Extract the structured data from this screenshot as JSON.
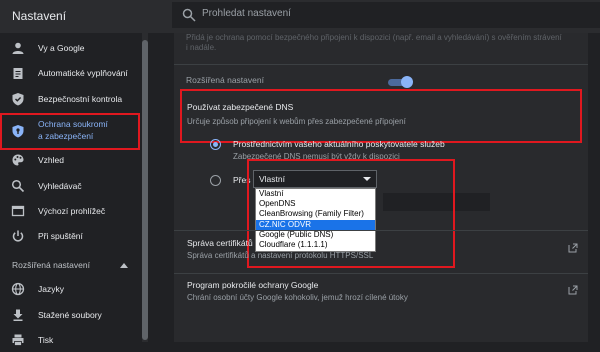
{
  "header": {
    "title": "Nastavení",
    "search_placeholder": "Prohledat nastavení"
  },
  "sidebar": {
    "items": [
      {
        "label": "Vy a Google",
        "icon": "person-icon"
      },
      {
        "label": "Automatické vyplňování",
        "icon": "clipboard-icon"
      },
      {
        "label": "Bezpečnostní kontrola",
        "icon": "shield-check-icon"
      },
      {
        "label_line1": "Ochrana soukromí",
        "label_line2": "a zabezpečení",
        "icon": "shield-icon"
      },
      {
        "label": "Vzhled",
        "icon": "palette-icon"
      },
      {
        "label": "Vyhledávač",
        "icon": "search-icon"
      },
      {
        "label": "Výchozí prohlížeč",
        "icon": "browser-icon"
      },
      {
        "label": "Při spuštění",
        "icon": "power-icon"
      }
    ],
    "advanced_section": "Rozšířená nastavení",
    "advanced_items": [
      {
        "label": "Jazyky",
        "icon": "globe-icon"
      },
      {
        "label": "Stažené soubory",
        "icon": "download-icon"
      },
      {
        "label": "Tisk",
        "icon": "printer-icon"
      }
    ]
  },
  "content": {
    "faded_line1": "Přidá je ochrana pomocí bezpečného připojení k dispozici (např. email a vyhledávání) s ověřením strávení",
    "faded_line2": "i nadále.",
    "section_title": "Rozšířená nastavení",
    "dns": {
      "title": "Používat zabezpečené DNS",
      "subtitle": "Určuje způsob připojení k webům přes zabezpečené připojení",
      "enabled": true,
      "option1": "Prostřednictvím vašeho aktuálního poskytovatele služeb",
      "option1_sub": "Zabezpečené DNS nemusí být vždy k dispozici",
      "option2_label": "Přes",
      "select_value": "Vlastní",
      "dropdown_options": [
        "Vlastní",
        "OpenDNS",
        "CleanBrowsing (Family Filter)",
        "CZ.NIC ODVR",
        "Google (Public DNS)",
        "Cloudflare (1.1.1.1)"
      ],
      "dropdown_selected": "CZ.NIC ODVR"
    },
    "certs": {
      "title": "Správa certifikátů",
      "subtitle": "Správa certifikátů a nastavení protokolu HTTPS/SSL"
    },
    "google_protection": {
      "title": "Program pokročilé ochrany Google",
      "subtitle": "Chrání osobní účty Google kohokoliv, jemuž hrozí cílené útoky"
    }
  },
  "colors": {
    "accent": "#8ab4f8",
    "highlight": "#e0181f",
    "selection": "#1a73e8"
  }
}
